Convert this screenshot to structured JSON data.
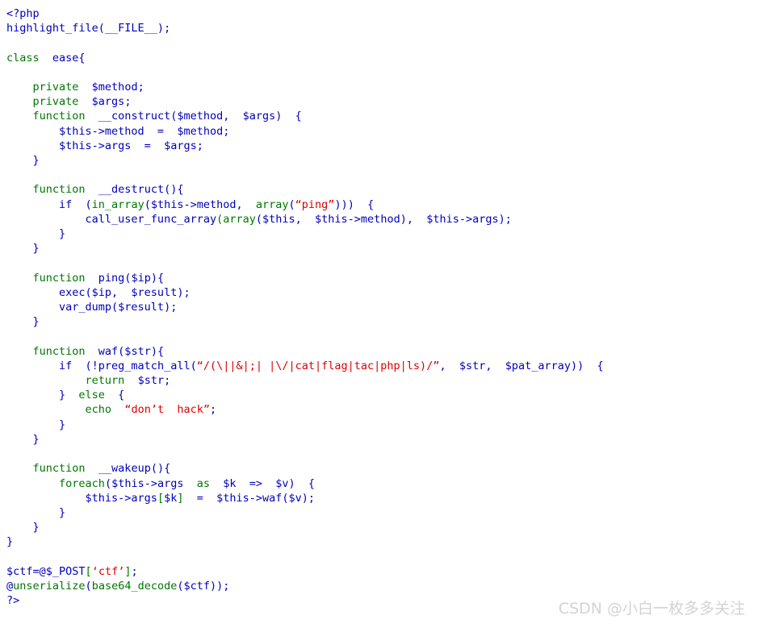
{
  "page": {
    "kind": "php-source-highlight",
    "background_color": "#ffffff"
  },
  "colors": {
    "keyword": "#007700",
    "default": "#0000bb",
    "string": "#dd0000",
    "comment": "#ff8000",
    "watermark": "#d3d3d3"
  },
  "source": {
    "language": "php",
    "lines": [
      [
        {
          "t": "<?php",
          "c": "def"
        }
      ],
      [
        {
          "t": "highlight_file(__FILE__);",
          "c": "def"
        }
      ],
      [
        {
          "t": "",
          "c": "def"
        }
      ],
      [
        {
          "t": "class ",
          "c": "kw"
        },
        {
          "t": " ease{",
          "c": "def"
        }
      ],
      [
        {
          "t": "",
          "c": "def"
        }
      ],
      [
        {
          "t": "    private ",
          "c": "kw"
        },
        {
          "t": " $method;",
          "c": "def"
        }
      ],
      [
        {
          "t": "    private ",
          "c": "kw"
        },
        {
          "t": " $args;",
          "c": "def"
        }
      ],
      [
        {
          "t": "    function ",
          "c": "kw"
        },
        {
          "t": " __construct($method,  $args)  {",
          "c": "def"
        }
      ],
      [
        {
          "t": "        $this->method  =  $method;",
          "c": "def"
        }
      ],
      [
        {
          "t": "        $this->args  =  $args;",
          "c": "def"
        }
      ],
      [
        {
          "t": "    }",
          "c": "def"
        }
      ],
      [
        {
          "t": "",
          "c": "def"
        }
      ],
      [
        {
          "t": "    function ",
          "c": "kw"
        },
        {
          "t": " __destruct(){",
          "c": "def"
        }
      ],
      [
        {
          "t": "        if ",
          "c": "def"
        },
        {
          "t": " (",
          "c": "def"
        },
        {
          "t": "in_array",
          "c": "kw"
        },
        {
          "t": "($this->method,  ",
          "c": "def"
        },
        {
          "t": "array",
          "c": "kw"
        },
        {
          "t": "(",
          "c": "def"
        },
        {
          "t": "“ping”",
          "c": "str"
        },
        {
          "t": ")))  {",
          "c": "def"
        }
      ],
      [
        {
          "t": "            call_user_func_array",
          "c": "def"
        },
        {
          "t": "(",
          "c": "kw"
        },
        {
          "t": "array",
          "c": "kw"
        },
        {
          "t": "(",
          "c": "def"
        },
        {
          "t": "$this,  $this->method)",
          "c": "def"
        },
        {
          "t": ",  $this->args);",
          "c": "def"
        }
      ],
      [
        {
          "t": "        }",
          "c": "def"
        }
      ],
      [
        {
          "t": "    }",
          "c": "def"
        }
      ],
      [
        {
          "t": "",
          "c": "def"
        }
      ],
      [
        {
          "t": "    function ",
          "c": "kw"
        },
        {
          "t": " ping($ip){",
          "c": "def"
        }
      ],
      [
        {
          "t": "        exec($ip,  $result);",
          "c": "def"
        }
      ],
      [
        {
          "t": "        var_dump($result);",
          "c": "def"
        }
      ],
      [
        {
          "t": "    }",
          "c": "def"
        }
      ],
      [
        {
          "t": "",
          "c": "def"
        }
      ],
      [
        {
          "t": "    function ",
          "c": "kw"
        },
        {
          "t": " waf($str){",
          "c": "def"
        }
      ],
      [
        {
          "t": "        if ",
          "c": "def"
        },
        {
          "t": " (!preg_match_all(",
          "c": "def"
        },
        {
          "t": "“/(\\||&|;| |\\/|cat|flag|tac|php|ls)/”",
          "c": "str"
        },
        {
          "t": ",  $str,  $pat_array))  {",
          "c": "def"
        }
      ],
      [
        {
          "t": "            return ",
          "c": "kw"
        },
        {
          "t": " $str;",
          "c": "def"
        }
      ],
      [
        {
          "t": "        }  ",
          "c": "def"
        },
        {
          "t": "else",
          "c": "kw"
        },
        {
          "t": "  {",
          "c": "def"
        }
      ],
      [
        {
          "t": "            ",
          "c": "def"
        },
        {
          "t": "echo ",
          "c": "kw"
        },
        {
          "t": " ",
          "c": "def"
        },
        {
          "t": "“don’t  hack”",
          "c": "str"
        },
        {
          "t": ";",
          "c": "def"
        }
      ],
      [
        {
          "t": "        }",
          "c": "def"
        }
      ],
      [
        {
          "t": "    }",
          "c": "def"
        }
      ],
      [
        {
          "t": "",
          "c": "def"
        }
      ],
      [
        {
          "t": "    function ",
          "c": "kw"
        },
        {
          "t": " __wakeup(){",
          "c": "def"
        }
      ],
      [
        {
          "t": "        ",
          "c": "def"
        },
        {
          "t": "foreach",
          "c": "kw"
        },
        {
          "t": "($this->args  ",
          "c": "def"
        },
        {
          "t": "as",
          "c": "kw"
        },
        {
          "t": "  $k  =>  $v)  {",
          "c": "def"
        }
      ],
      [
        {
          "t": "            $this->args",
          "c": "def"
        },
        {
          "t": "[",
          "c": "kw"
        },
        {
          "t": "$k",
          "c": "def"
        },
        {
          "t": "]",
          "c": "kw"
        },
        {
          "t": "  =  $this->waf($v);",
          "c": "def"
        }
      ],
      [
        {
          "t": "        }",
          "c": "def"
        }
      ],
      [
        {
          "t": "    }",
          "c": "def"
        }
      ],
      [
        {
          "t": "}",
          "c": "def"
        }
      ],
      [
        {
          "t": "",
          "c": "def"
        }
      ],
      [
        {
          "t": "$ctf=@$_POST",
          "c": "def"
        },
        {
          "t": "[",
          "c": "kw"
        },
        {
          "t": "‘ctf’",
          "c": "str"
        },
        {
          "t": "]",
          "c": "kw"
        },
        {
          "t": ";",
          "c": "def"
        }
      ],
      [
        {
          "t": "@",
          "c": "def"
        },
        {
          "t": "unserialize",
          "c": "kw"
        },
        {
          "t": "(",
          "c": "def"
        },
        {
          "t": "base64_decode",
          "c": "kw"
        },
        {
          "t": "($ctf));",
          "c": "def"
        }
      ],
      [
        {
          "t": "?>",
          "c": "def"
        }
      ]
    ],
    "plain_text": "<?php\nhighlight_file(__FILE__);\n\nclass  ease{\n\n    private  $method;\n    private  $args;\n    function  __construct($method,  $args)  {\n        $this->method  =  $method;\n        $this->args  =  $args;\n    }\n\n    function  __destruct(){\n        if  (in_array($this->method,  array(“ping”)))  {\n            call_user_func_array(array($this,  $this->method),  $this->args);\n        }\n    }\n\n    function  ping($ip){\n        exec($ip,  $result);\n        var_dump($result);\n    }\n\n    function  waf($str){\n        if  (!preg_match_all(“/(\\||&|;| |\\/|cat|flag|tac|php|ls)/”,  $str,  $pat_array))  {\n            return  $str;\n        }  else  {\n            echo  “don’t  hack”;\n        }\n    }\n\n    function  __wakeup(){\n        foreach($this->args  as  $k  =>  $v)  {\n            $this->args[$k]  =  $this->waf($v);\n        }\n    }\n}\n\n$ctf=@$_POST[‘ctf’];\n@unserialize(base64_decode($ctf));\n?>"
  },
  "watermark": {
    "text": "CSDN @小白一枚多多关注"
  }
}
